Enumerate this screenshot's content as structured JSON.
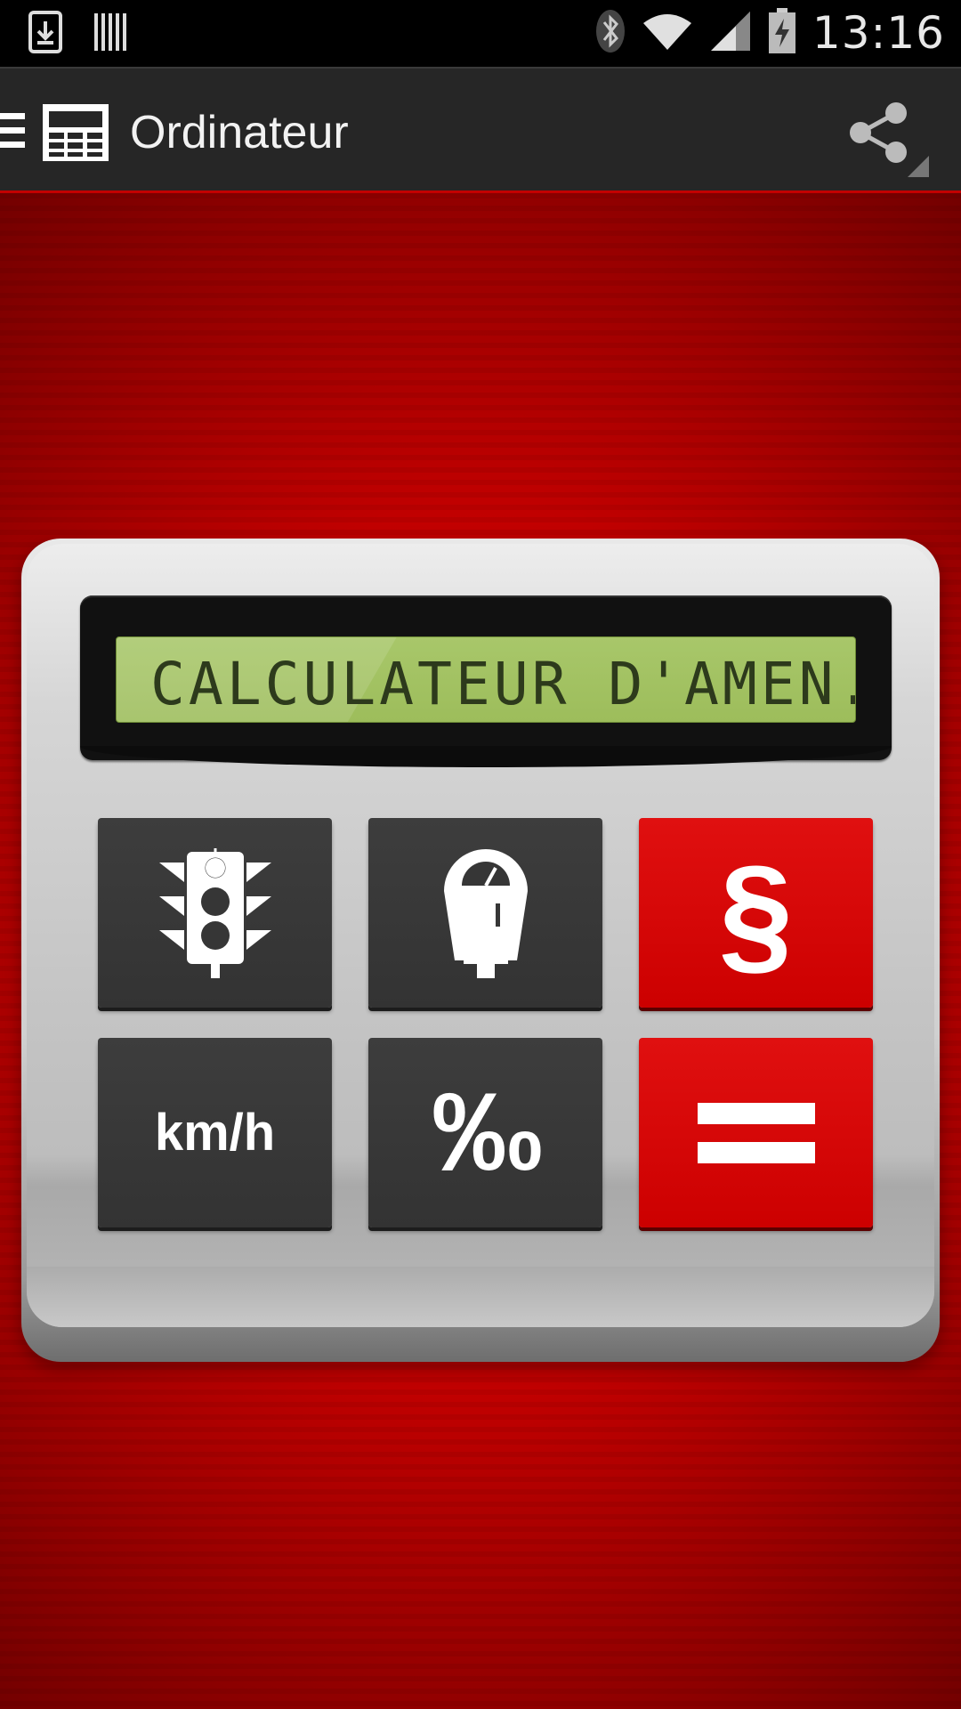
{
  "status_bar": {
    "time": "13:16",
    "icons": [
      "download-notification-icon",
      "barcode-notification-icon",
      "bluetooth-icon",
      "wifi-icon",
      "signal-icon",
      "battery-charging-icon"
    ]
  },
  "action_bar": {
    "title": "Ordinateur",
    "icons": [
      "drawer-menu-icon",
      "calculator-app-icon",
      "share-icon"
    ]
  },
  "calculator": {
    "display_text": "CALCULATEUR D'AMEN..",
    "keys": [
      {
        "id": "traffic-light",
        "icon": "traffic-light-icon",
        "label": ""
      },
      {
        "id": "parking-meter",
        "icon": "parking-meter-icon",
        "label": ""
      },
      {
        "id": "section",
        "icon": "",
        "label": "§"
      },
      {
        "id": "speed",
        "icon": "",
        "label": "km/h"
      },
      {
        "id": "permille",
        "icon": "",
        "label": "‰"
      },
      {
        "id": "equals",
        "icon": "equals-icon",
        "label": ""
      }
    ]
  },
  "colors": {
    "background_red": "#c10000",
    "key_dark": "#363636",
    "key_red": "#d40000",
    "lcd_green": "#a1c060",
    "action_bar": "#262626"
  }
}
